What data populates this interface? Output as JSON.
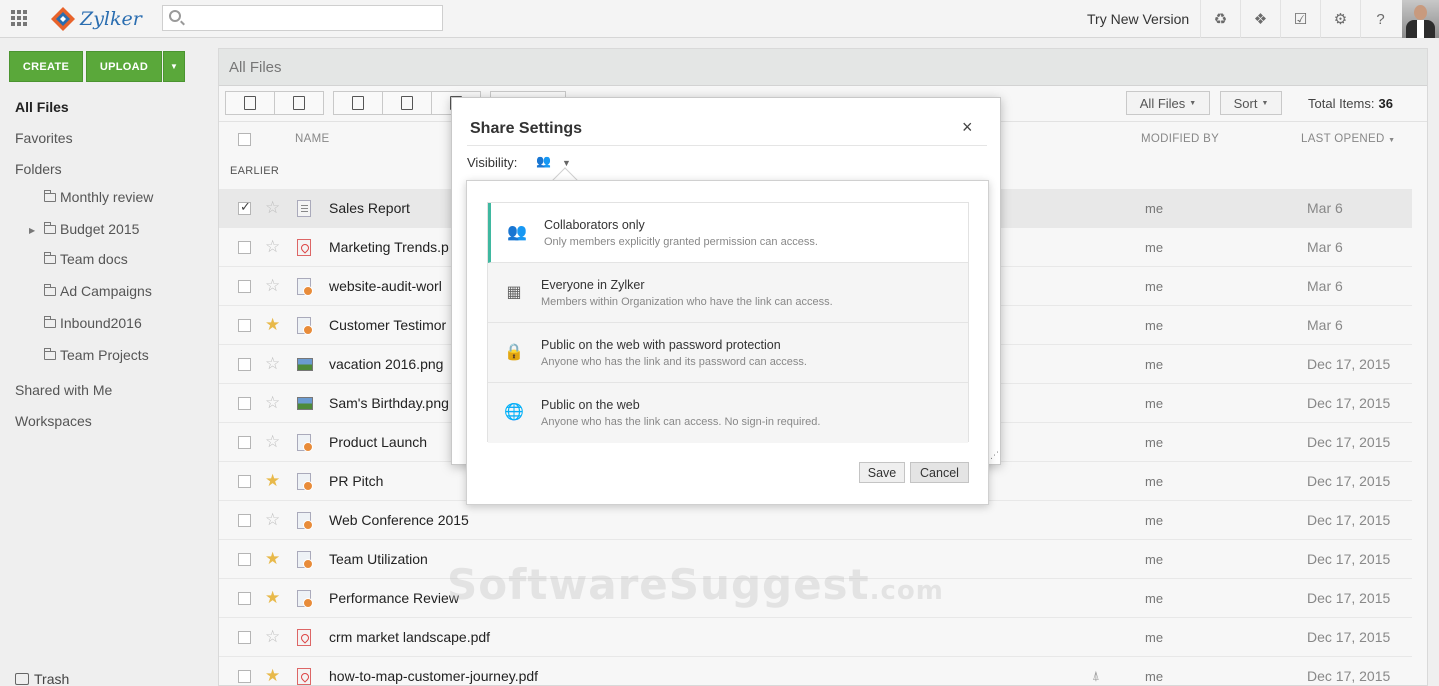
{
  "app": {
    "name": "Zylker",
    "try_new": "Try New Version"
  },
  "search": {
    "placeholder": ""
  },
  "top_icons": [
    "recycle-icon",
    "dropbox-icon",
    "task-icon",
    "gear-icon",
    "help-icon"
  ],
  "sidebar": {
    "create_label": "CREATE",
    "upload_label": "UPLOAD",
    "all_files": "All Files",
    "favorites": "Favorites",
    "folders": "Folders",
    "folder_items": [
      "Monthly review",
      "Budget 2015",
      "Team docs",
      "Ad Campaigns",
      "Inbound2016",
      "Team Projects"
    ],
    "shared": "Shared with Me",
    "workspaces": "Workspaces",
    "trash": "Trash"
  },
  "main": {
    "title": "All Files",
    "filter_label": "All Files",
    "sort_label": "Sort",
    "total_label": "Total Items:",
    "total_value": "36",
    "col_name": "NAME",
    "col_modified": "MODIFIED BY",
    "col_opened": "LAST OPENED",
    "section": "EARLIER"
  },
  "files": [
    {
      "name": "Sales Report",
      "type": "doc",
      "starred": false,
      "selected": true,
      "modified": "me",
      "opened": "Mar 6"
    },
    {
      "name": "Marketing Trends.p",
      "type": "pdf",
      "starred": false,
      "selected": false,
      "modified": "me",
      "opened": "Mar 6"
    },
    {
      "name": "website-audit-worl",
      "type": "sheet",
      "starred": false,
      "selected": false,
      "modified": "me",
      "opened": "Mar 6"
    },
    {
      "name": "Customer Testimor",
      "type": "sheet",
      "starred": true,
      "selected": false,
      "modified": "me",
      "opened": "Mar 6"
    },
    {
      "name": "vacation 2016.png",
      "type": "img",
      "starred": false,
      "selected": false,
      "modified": "me",
      "opened": "Dec 17, 2015"
    },
    {
      "name": "Sam's Birthday.png",
      "type": "img",
      "starred": false,
      "selected": false,
      "modified": "me",
      "opened": "Dec 17, 2015"
    },
    {
      "name": "Product Launch",
      "type": "sheet",
      "starred": false,
      "selected": false,
      "modified": "me",
      "opened": "Dec 17, 2015"
    },
    {
      "name": "PR Pitch",
      "type": "sheet",
      "starred": true,
      "selected": false,
      "modified": "me",
      "opened": "Dec 17, 2015"
    },
    {
      "name": "Web Conference 2015",
      "type": "sheet",
      "starred": false,
      "selected": false,
      "modified": "me",
      "opened": "Dec 17, 2015"
    },
    {
      "name": "Team Utilization",
      "type": "sheet",
      "starred": true,
      "selected": false,
      "modified": "me",
      "opened": "Dec 17, 2015"
    },
    {
      "name": "Performance Review",
      "type": "sheet",
      "starred": true,
      "selected": false,
      "modified": "me",
      "opened": "Dec 17, 2015"
    },
    {
      "name": "crm market landscape.pdf",
      "type": "pdf",
      "starred": false,
      "selected": false,
      "modified": "me",
      "opened": "Dec 17, 2015"
    },
    {
      "name": "how-to-map-customer-journey.pdf",
      "type": "pdf",
      "starred": true,
      "selected": false,
      "modified": "me",
      "opened": "Dec 17, 2015"
    }
  ],
  "dialog": {
    "title": "Share Settings",
    "close": "×",
    "visibility_label": "Visibility:",
    "options": [
      {
        "title": "Collaborators only",
        "desc": "Only members explicitly granted permission can access.",
        "icon": "group-icon",
        "selected": true
      },
      {
        "title": "Everyone in Zylker",
        "desc": "Members within Organization who have the link can access.",
        "icon": "building-icon",
        "selected": false
      },
      {
        "title": "Public on the web with password protection",
        "desc": "Anyone who has the link and its password can access.",
        "icon": "globe-lock-icon",
        "selected": false
      },
      {
        "title": "Public on the web",
        "desc": "Anyone who has the link can access. No sign-in required.",
        "icon": "globe-icon",
        "selected": false
      }
    ],
    "save": "Save",
    "cancel": "Cancel"
  },
  "watermark": {
    "main": "SoftwareSuggest",
    "suffix": ".com"
  },
  "colors": {
    "accent_green": "#5aa83a",
    "selected_border": "#3fb8a0",
    "star": "#e8b94a"
  }
}
